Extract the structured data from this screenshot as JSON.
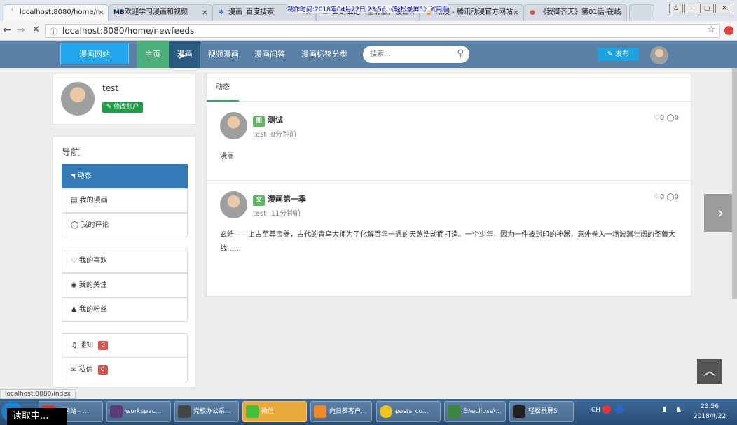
{
  "browser": {
    "tabs": [
      {
        "title": "localhost:8080/home/r",
        "icon": "page-icon"
      },
      {
        "title": "欢迎学习漫画和视频",
        "icon": "mb-icon",
        "icon_text": "MB"
      },
      {
        "title": "漫画_百度搜索",
        "icon": "baidu-paw-icon"
      },
      {
        "title": "玄鹄战记（全彩版）漫画",
        "icon": "page-icon"
      },
      {
        "title": "动漫 - 腾讯动漫官方网站",
        "icon": "page-icon"
      },
      {
        "title": "《我御齐天》第01话-在线",
        "icon": "page-icon"
      }
    ],
    "recording_banner": "制作时间:2018年04月22日 23:56 《轻松录屏5》试用版",
    "url": "localhost:8080/home/newfeeds",
    "status_url": "localhost:8080/index"
  },
  "site": {
    "logo": "漫画网站",
    "nav": [
      "主页",
      "漫画",
      "视频漫画",
      "漫画问答",
      "漫画标签分类"
    ],
    "search_placeholder": "搜索...",
    "publish": "✎ 发布"
  },
  "profile": {
    "username": "test",
    "edit_button": "✎ 修改账户"
  },
  "sidebar": {
    "heading": "导航",
    "group1": [
      {
        "label": "动态",
        "icon": "rss-icon",
        "glyph": "◥",
        "active": true
      },
      {
        "label": "我的漫画",
        "icon": "document-icon",
        "glyph": "▤"
      },
      {
        "label": "我的评论",
        "icon": "comment-icon",
        "glyph": "◯"
      }
    ],
    "group2": [
      {
        "label": "我的喜欢",
        "icon": "heart-icon",
        "glyph": "♡"
      },
      {
        "label": "我的关注",
        "icon": "eye-icon",
        "glyph": "◉"
      },
      {
        "label": "我的粉丝",
        "icon": "users-icon",
        "glyph": "♟"
      }
    ],
    "group3": [
      {
        "label": "通知",
        "icon": "bell-icon",
        "glyph": "♫",
        "count": "0"
      },
      {
        "label": "私信",
        "icon": "envelope-icon",
        "glyph": "✉",
        "count": "0"
      }
    ]
  },
  "feed": {
    "tab": "动态",
    "posts": [
      {
        "tag": "图",
        "title": "测试",
        "author": "test",
        "time": "8分钟前",
        "likes": "0",
        "comments": "0",
        "body": "漫画"
      },
      {
        "tag": "文",
        "title": "漫画第一季",
        "author": "test",
        "time": "11分钟前",
        "likes": "0",
        "comments": "0",
        "body": "玄皓——上古至尊宝器，古代的青乌大师为了化解百年一遇的天煞浩劫而打造。一个少年，因为一件被封印的神器，意外卷入一场波澜壮阔的圣兽大战……"
      }
    ]
  },
  "overlay": {
    "loading": "读取中..."
  },
  "taskbar": {
    "items": [
      "画网站 - ...",
      "workspac...",
      "党校办公系...",
      "微信",
      "向日葵客户...",
      "posts_co...",
      "E:\\eclipse\\...",
      "轻松录屏5"
    ],
    "time": "23:56",
    "date": "2018/4/22",
    "lang": "CH"
  },
  "colors": {
    "header": "#5a80a8",
    "active_nav": "#337ab7",
    "accent": "#1aa3e0",
    "green": "#1f9d46"
  }
}
